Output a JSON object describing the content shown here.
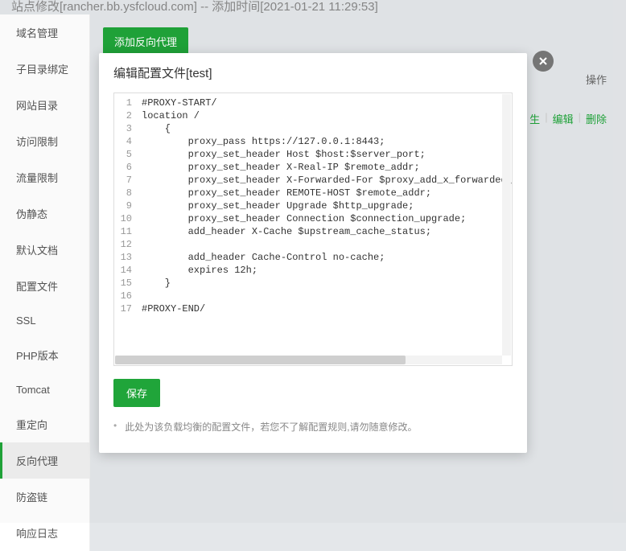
{
  "page_title": "站点修改[rancher.bb.ysfcloud.com] -- 添加时间[2021-01-21 11:29:53]",
  "sidebar": {
    "items": [
      {
        "label": "域名管理"
      },
      {
        "label": "子目录绑定"
      },
      {
        "label": "网站目录"
      },
      {
        "label": "访问限制"
      },
      {
        "label": "流量限制"
      },
      {
        "label": "伪静态"
      },
      {
        "label": "默认文档"
      },
      {
        "label": "配置文件"
      },
      {
        "label": "SSL"
      },
      {
        "label": "PHP版本"
      },
      {
        "label": "Tomcat"
      },
      {
        "label": "重定向"
      },
      {
        "label": "反向代理",
        "active": true
      },
      {
        "label": "防盗链"
      },
      {
        "label": "响应日志"
      }
    ]
  },
  "main": {
    "add_button": "添加反向代理",
    "table_header_op": "操作",
    "row": {
      "action_prop": "生",
      "action_edit": "编辑",
      "action_delete": "删除"
    }
  },
  "modal": {
    "title": "编辑配置文件[test]",
    "save_label": "保存",
    "note": "此处为该负载均衡的配置文件，若您不了解配置规则,请勿随意修改。",
    "code_lines": [
      "#PROXY-START/",
      "location /",
      "    {",
      "        proxy_pass https://127.0.0.1:8443;",
      "        proxy_set_header Host $host:$server_port;",
      "        proxy_set_header X-Real-IP $remote_addr;",
      "        proxy_set_header X-Forwarded-For $proxy_add_x_forwarded_for;",
      "        proxy_set_header REMOTE-HOST $remote_addr;",
      "        proxy_set_header Upgrade $http_upgrade;",
      "        proxy_set_header Connection $connection_upgrade;",
      "        add_header X-Cache $upstream_cache_status;",
      "        ",
      "        add_header Cache-Control no-cache;",
      "        expires 12h;",
      "    }",
      "",
      "#PROXY-END/"
    ]
  }
}
